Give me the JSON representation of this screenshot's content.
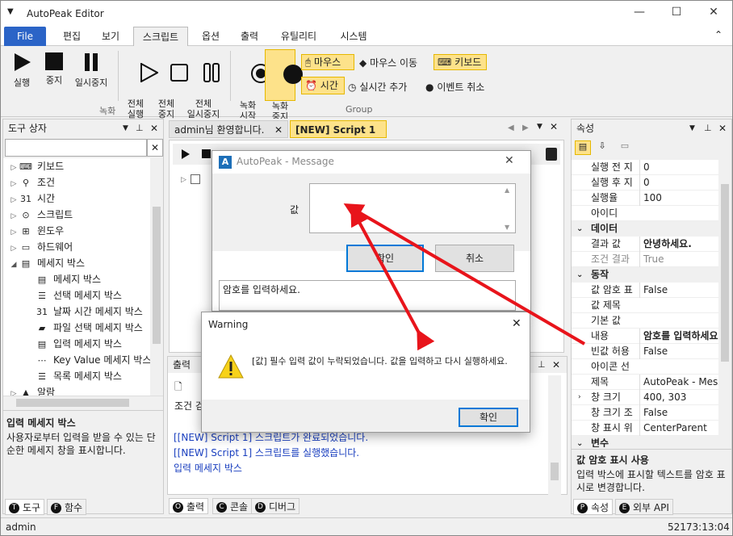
{
  "app": {
    "title": "AutoPeak Editor",
    "minimize": "—",
    "maximize": "☐",
    "close": "✕",
    "collapse_ribbon": "⌃"
  },
  "menu": {
    "file": "File",
    "items": [
      "편집",
      "보기",
      "스크립트",
      "옵션",
      "출력",
      "유틸리티",
      "시스템"
    ]
  },
  "ribbon": {
    "run": "실행",
    "stop": "중지",
    "pause": "일시중지",
    "run_all": "전체\n실행",
    "stop_all": "전체\n중지",
    "pause_all": "전체\n일시중지",
    "rec_start": "녹화\n시작",
    "rec_stop": "녹화\n중지",
    "mouse": "마우스",
    "mouse_move": "마우스 이동",
    "keyboard": "키보드",
    "time": "시간",
    "realtime_add": "실시간 추가",
    "event_cancel": "이벤트 취소",
    "group_record": "녹화",
    "group_group": "Group"
  },
  "toolbox": {
    "title": "도구 상자",
    "search_value": "",
    "clear": "✕",
    "items": [
      {
        "label": "키보드",
        "icon": "keyboard-icon",
        "glyph": "⌨",
        "indent": 0,
        "expander": "▷"
      },
      {
        "label": "조건",
        "icon": "condition-icon",
        "glyph": "⚲",
        "indent": 0,
        "expander": "▷"
      },
      {
        "label": "시간",
        "icon": "calendar-icon",
        "glyph": "31",
        "indent": 0,
        "expander": "▷"
      },
      {
        "label": "스크립트",
        "icon": "script-icon",
        "glyph": "⊙",
        "indent": 0,
        "expander": "▷"
      },
      {
        "label": "윈도우",
        "icon": "windows-icon",
        "glyph": "⊞",
        "indent": 0,
        "expander": "▷"
      },
      {
        "label": "하드웨어",
        "icon": "hardware-icon",
        "glyph": "▭",
        "indent": 0,
        "expander": "▷"
      },
      {
        "label": "메세지 박스",
        "icon": "messagebox-icon",
        "glyph": "▤",
        "indent": 0,
        "expander": "◢"
      },
      {
        "label": "메세지 박스",
        "icon": "messagebox-icon",
        "glyph": "▤",
        "indent": 1,
        "expander": ""
      },
      {
        "label": "선택 메세지 박스",
        "icon": "list-icon",
        "glyph": "☰",
        "indent": 1,
        "expander": ""
      },
      {
        "label": "날짜 시간 메세지 박스",
        "icon": "calendar-icon",
        "glyph": "31",
        "indent": 1,
        "expander": ""
      },
      {
        "label": "파일 선택 메세지 박스",
        "icon": "folder-icon",
        "glyph": "▰",
        "indent": 1,
        "expander": ""
      },
      {
        "label": "입력 메세지 박스",
        "icon": "input-icon",
        "glyph": "▤",
        "indent": 1,
        "expander": ""
      },
      {
        "label": "Key Value 메세지 박스",
        "icon": "keyvalue-icon",
        "glyph": "⋯",
        "indent": 1,
        "expander": ""
      },
      {
        "label": "목록 메세지 박스",
        "icon": "list-icon",
        "glyph": "☰",
        "indent": 1,
        "expander": ""
      },
      {
        "label": "알람",
        "icon": "bell-icon",
        "glyph": "▲",
        "indent": 0,
        "expander": "▷"
      }
    ],
    "desc_title": "입력 메세지 박스",
    "desc_text": "사용자로부터 입력을 받을 수 있는 단순한 메세지 창을 표시합니다.",
    "tabs": [
      {
        "dot": "T",
        "label": "도구"
      },
      {
        "dot": "F",
        "label": "함수"
      }
    ]
  },
  "editor": {
    "tabs": [
      "admin님 환영합니다.",
      "[NEW] Script 1"
    ],
    "tab_close": "✕"
  },
  "output": {
    "title": "출력",
    "partial_line": "조건 검",
    "lines": [
      "[[NEW] Script 1] 스크립트가 완료되었습니다.",
      "[[NEW] Script 1] 스크립트를 실행했습니다.",
      "입력 메세지 박스"
    ],
    "tabs": [
      {
        "dot": "O",
        "label": "출력"
      },
      {
        "dot": "C",
        "label": "콘솔"
      },
      {
        "dot": "D",
        "label": "디버그"
      }
    ]
  },
  "properties": {
    "title": "속성",
    "rows": [
      {
        "type": "row",
        "name": "실행 전 지",
        "value": "0"
      },
      {
        "type": "row",
        "name": "실행 후 지",
        "value": "0"
      },
      {
        "type": "row",
        "name": "실행율",
        "value": "100"
      },
      {
        "type": "row",
        "name": "아이디",
        "value": ""
      },
      {
        "type": "cat",
        "name": "데이터",
        "value": ""
      },
      {
        "type": "row",
        "name": "결과 값",
        "value": "안녕하세요.",
        "bold": true
      },
      {
        "type": "row",
        "name": "조건 결과",
        "value": "True",
        "gray": true
      },
      {
        "type": "cat",
        "name": "동작",
        "value": ""
      },
      {
        "type": "row",
        "name": "값 암호 표",
        "value": "False"
      },
      {
        "type": "row",
        "name": "값 제목",
        "value": ""
      },
      {
        "type": "row",
        "name": "기본 값",
        "value": ""
      },
      {
        "type": "row",
        "name": "내용",
        "value": "암호를 입력하세요",
        "bold": true
      },
      {
        "type": "row",
        "name": "빈값 허용",
        "value": "False"
      },
      {
        "type": "row",
        "name": "아이콘 선",
        "value": ""
      },
      {
        "type": "row",
        "name": "제목",
        "value": "AutoPeak - Messa"
      },
      {
        "type": "row",
        "name": "창 크기",
        "value": "400, 303",
        "exp": true
      },
      {
        "type": "row",
        "name": "창 크기 조",
        "value": "False"
      },
      {
        "type": "row",
        "name": "창 표시 위",
        "value": "CenterParent"
      },
      {
        "type": "cat",
        "name": "변수",
        "value": ""
      }
    ],
    "desc_title": "값 암호 표시 사용",
    "desc_text": "입력 박스에 표시할 텍스트를 암호 표시로 변경합니다.",
    "tabs": [
      {
        "dot": "P",
        "label": "속성"
      },
      {
        "dot": "E",
        "label": "외부 API"
      }
    ]
  },
  "message_dialog": {
    "title": "AutoPeak - Message",
    "value_label": "값",
    "input_value": "",
    "ok": "확인",
    "cancel": "취소",
    "content": "암호를 입력하세요."
  },
  "warning_dialog": {
    "title": "Warning",
    "message": "[값] 필수 입력 값이 누락되었습니다. 값을 입력하고 다시 실행하세요.",
    "ok": "확인"
  },
  "status": {
    "user": "admin",
    "time": "52173:13:04"
  },
  "colors": {
    "accent": "#2b64c7",
    "highlight": "#fde28a",
    "arrow": "#e8141b",
    "output_text": "#1a3fbf"
  }
}
